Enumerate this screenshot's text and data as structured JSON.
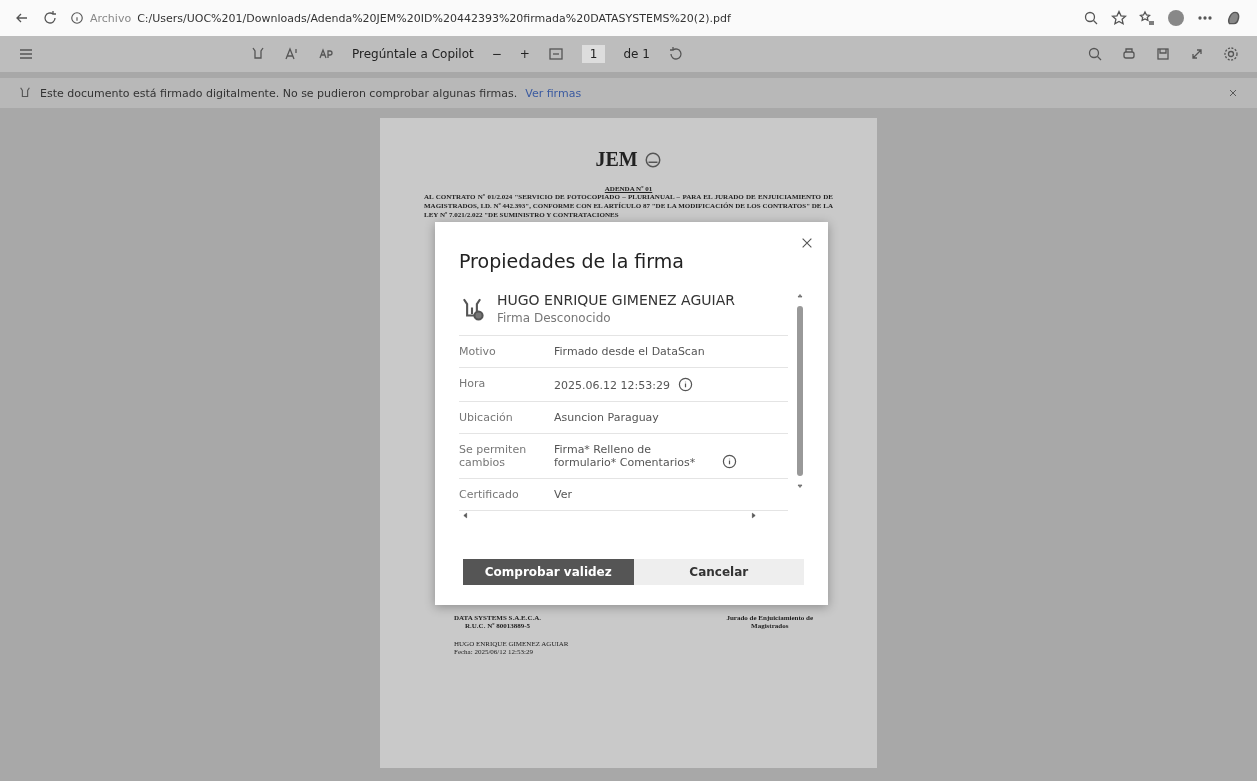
{
  "browser": {
    "address_prefix": "Archivo",
    "url": "C:/Users/UOC%201/Downloads/Adenda%20JEM%20ID%20442393%20firmada%20DATASYSTEMS%20(2).pdf"
  },
  "toolbar": {
    "copilot": "Pregúntale a Copilot",
    "zoom_out": "−",
    "zoom_in": "+",
    "page": "1",
    "page_total": "de 1"
  },
  "infobar": {
    "message": "Este documento está firmado digitalmente. No se pudieron comprobar algunas firmas.",
    "link": "Ver firmas"
  },
  "document": {
    "logo": "JEM",
    "title": "ADENDA Nº 01",
    "heading": "AL CONTRATO Nº 01/2.024 \"SERVICIO DE FOTOCOPIADO – PLURIANUAL – PARA EL JURADO DE ENJUICIAMIENTO DE MAGISTRADOS, I.D. Nº 442.393\", CONFORME CON EL ARTÍCULO 87 \"DE LA MODIFICACIÓN DE LOS CONTRATOS\" DE LA LEY Nº 7.021/2.022 \"DE SUMINISTRO Y CONTRATACIONES",
    "signers": [
      {
        "lines": [
          "DATA SYSTEMS S.A.E.C.A.",
          "R.U.C. Nº 80013889-5"
        ]
      },
      {
        "lines": [
          "Jurado de Enjuiciamiento de",
          "Magistrados"
        ]
      }
    ],
    "stamp": [
      "HUGO ENRIQUE GIMENEZ AGUIAR",
      "Fecha: 2025/06/12 12:53:29"
    ]
  },
  "dialog": {
    "title": "Propiedades de la firma",
    "signer": "HUGO ENRIQUE GIMENEZ AGUIAR",
    "status": "Firma Desconocido",
    "rows": [
      {
        "label": "Motivo",
        "value": "Firmado desde el DataScan",
        "info": false
      },
      {
        "label": "Hora",
        "value": "2025.06.12 12:53:29",
        "info": true
      },
      {
        "label": "Ubicación",
        "value": "Asuncion Paraguay",
        "info": false
      },
      {
        "label": "Se permiten cambios",
        "value": "Firma* Relleno de formulario* Comentarios*",
        "info": true
      },
      {
        "label": "Certificado",
        "value": "Ver",
        "info": false
      }
    ],
    "buttons": [
      {
        "label": "Comprobar validez",
        "kind": "primary"
      },
      {
        "label": "Cancelar",
        "kind": "secondary"
      }
    ]
  }
}
